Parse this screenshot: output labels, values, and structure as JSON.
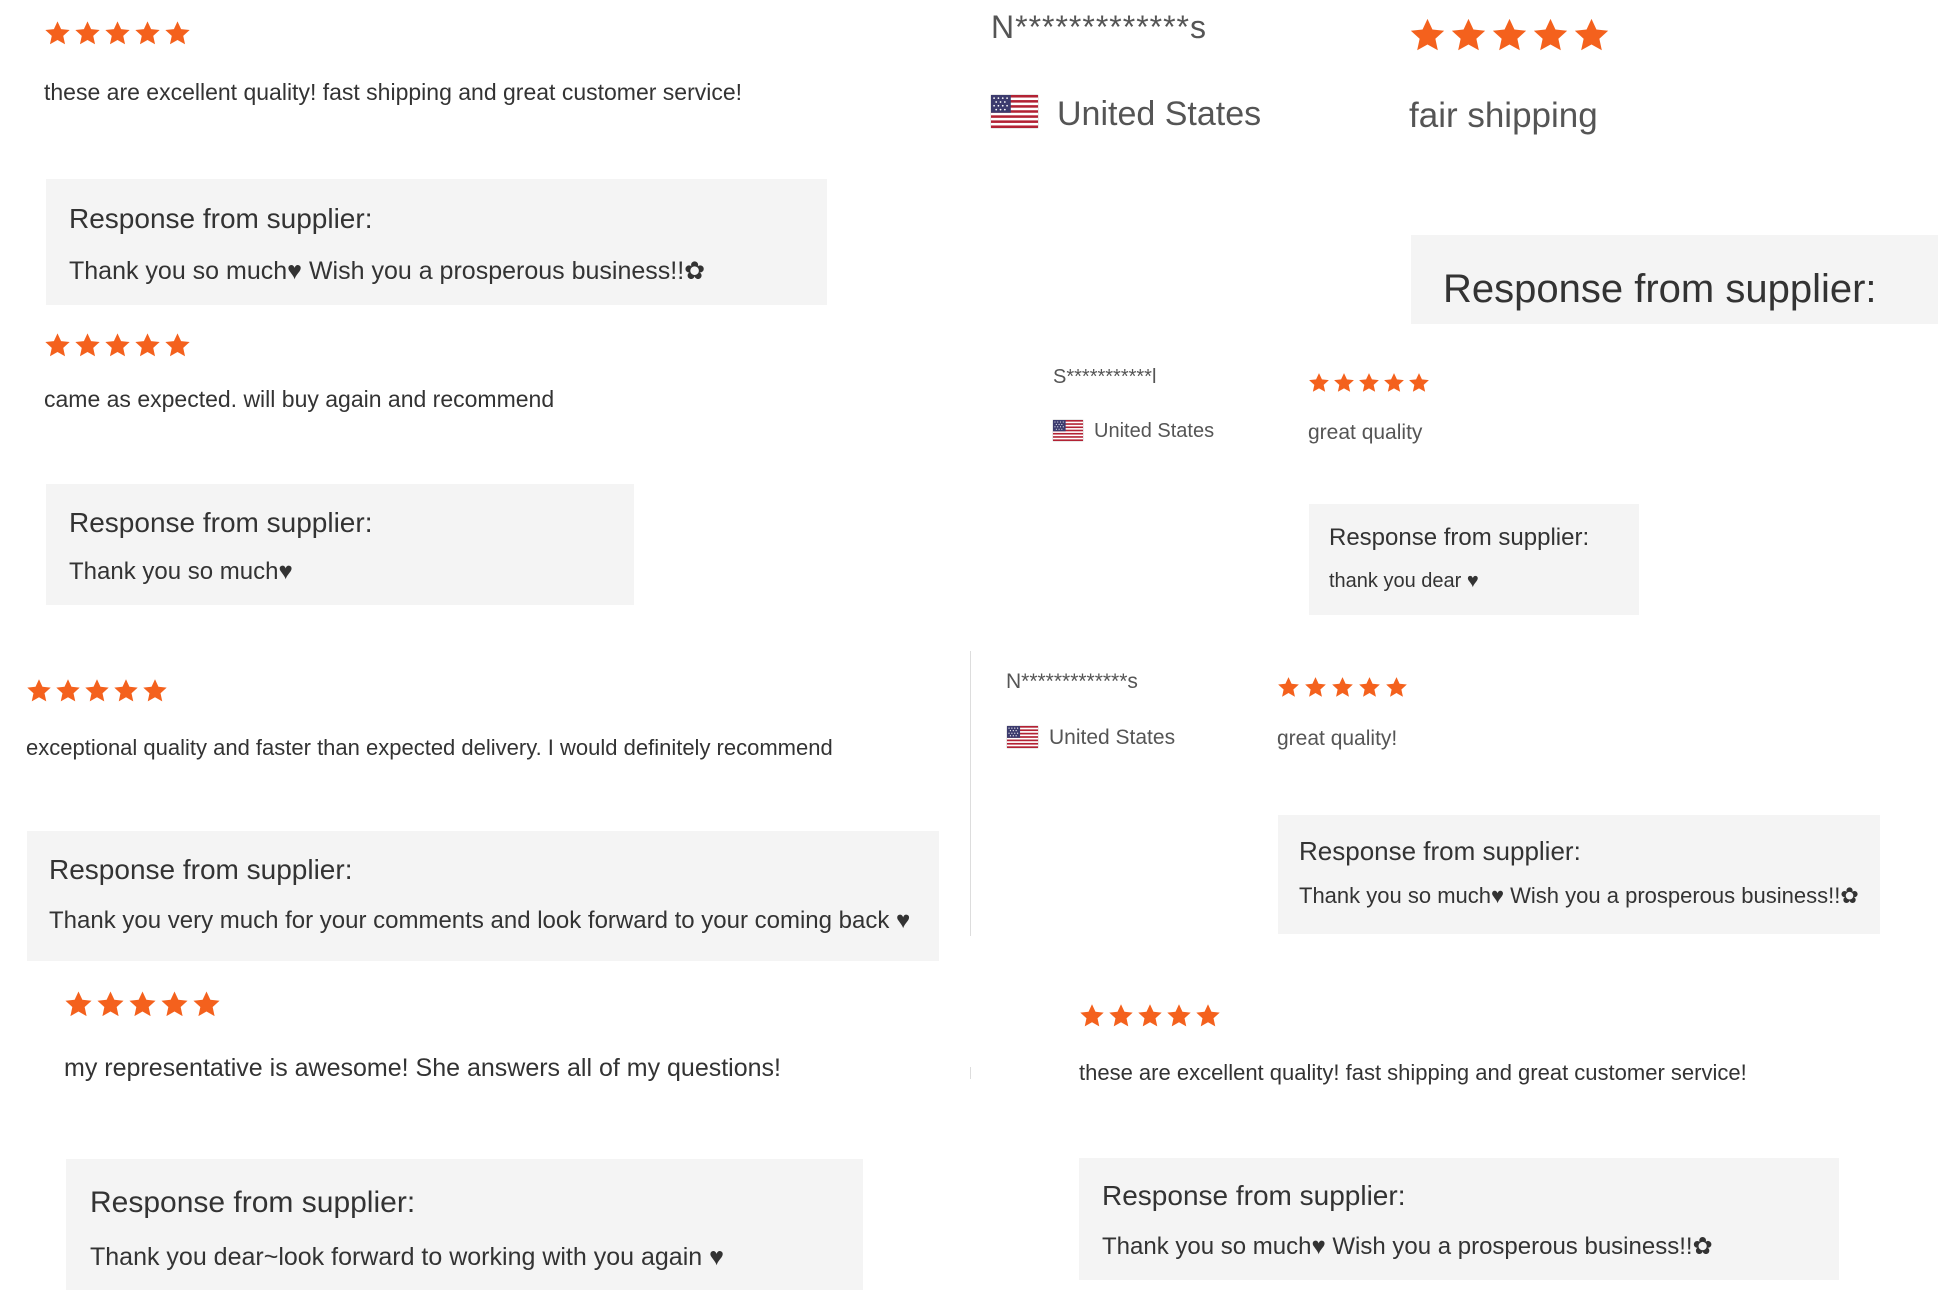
{
  "colors": {
    "star": "#f4611d",
    "text": "#333333",
    "muted": "#555555",
    "response_bg": "#f4f4f4",
    "divider": "#dddddd"
  },
  "icons": {
    "rating": "star-icon",
    "country_flag": "us-flag-icon"
  },
  "left_column": {
    "reviews": [
      {
        "rating": 5,
        "text": "these are excellent quality! fast shipping and great customer service!",
        "response_heading": "Response from supplier:",
        "response": "Thank you so much♥ Wish you a prosperous business!!✿"
      },
      {
        "rating": 5,
        "text": "came as expected. will buy again and recommend",
        "response_heading": "Response from supplier:",
        "response": "Thank you so much♥"
      },
      {
        "rating": 5,
        "text": "exceptional quality and faster than expected delivery. I would definitely recommend",
        "response_heading": "Response from supplier:",
        "response": "Thank you very much for your comments and look forward to your coming back ♥"
      },
      {
        "rating": 5,
        "text": "my representative is awesome! She answers all of my questions!",
        "response_heading": "Response from supplier:",
        "response": "Thank you dear~look forward to working with you again ♥"
      }
    ]
  },
  "right_column": {
    "reviews": [
      {
        "reviewer": "N*************s",
        "country": "United States",
        "rating": 5,
        "text": "fair shipping",
        "response_heading": "Response from supplier:"
      },
      {
        "reviewer": "S***********l",
        "country": "United States",
        "rating": 5,
        "text": "great quality",
        "response_heading": "Response from supplier:",
        "response": "thank you dear ♥"
      },
      {
        "reviewer": "N*************s",
        "country": "United States",
        "rating": 5,
        "text": "great quality!",
        "response_heading": "Response from supplier:",
        "response": "Thank you so much♥ Wish you a prosperous business!!✿"
      },
      {
        "rating": 5,
        "text": "these are excellent quality! fast shipping and great customer service!",
        "response_heading": "Response from supplier:",
        "response": "Thank you so much♥ Wish you a prosperous business!!✿"
      }
    ]
  }
}
